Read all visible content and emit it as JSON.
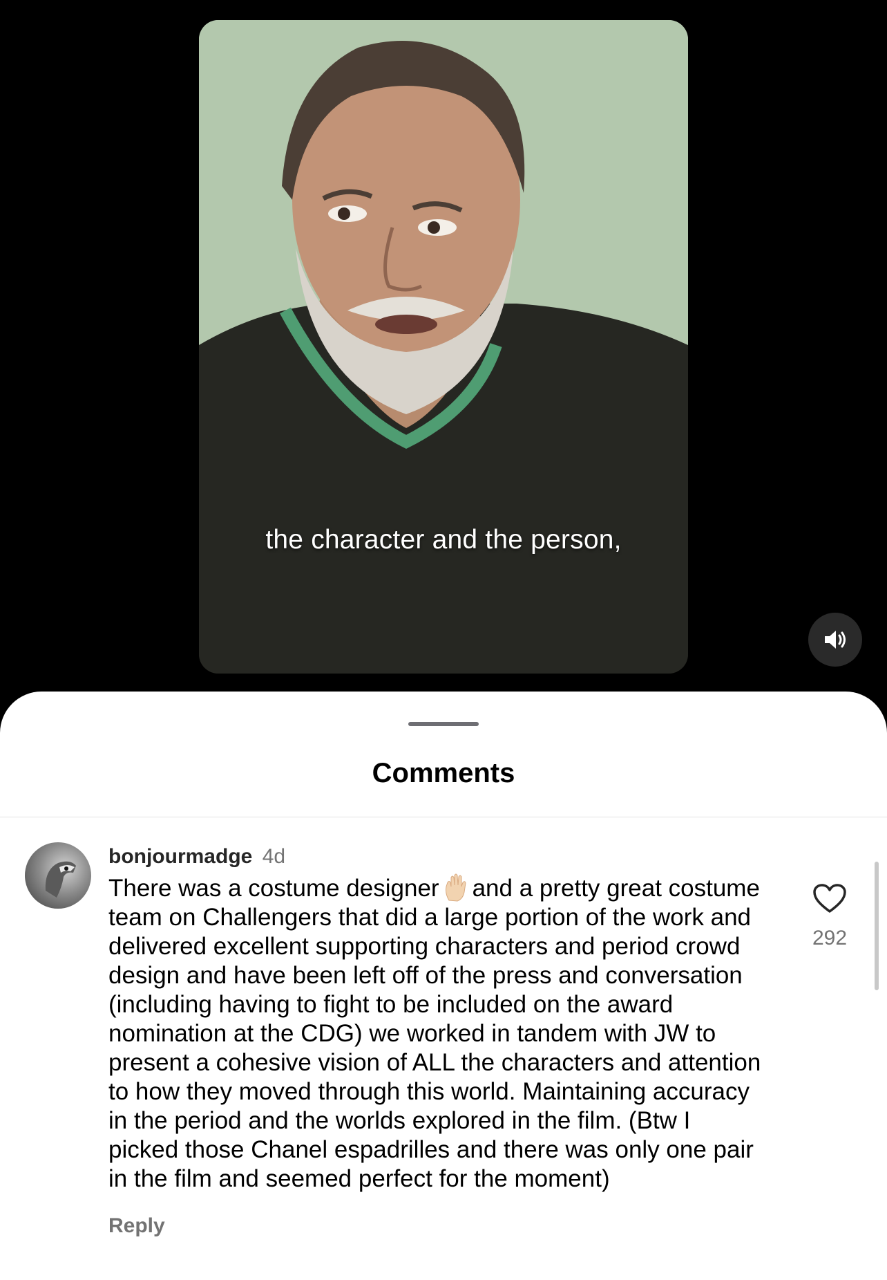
{
  "video": {
    "caption": "the character and the person,",
    "volume_icon": "speaker-on-icon"
  },
  "comments_sheet": {
    "title": "Comments",
    "comment": {
      "username": "bonjourmadge",
      "timestamp": "4d",
      "text_before_emoji": "There was a costume designer",
      "emoji": "✋",
      "text_after_emoji": "and a pretty great costume team on Challengers that did a large portion of the work and delivered excellent supporting characters and period crowd design and have been left off of the press and conversation (including having to fight to be included on the award nomination at the CDG) we worked in tandem with JW to present a cohesive vision of ALL  the characters and attention to how they moved through this world.  Maintaining accuracy in the period and the worlds explored in the film. (Btw I picked those Chanel espadrilles and there was only one pair in the film and seemed perfect for the moment)",
      "reply_label": "Reply",
      "like_count": "292",
      "like_icon": "heart-outline-icon"
    }
  }
}
